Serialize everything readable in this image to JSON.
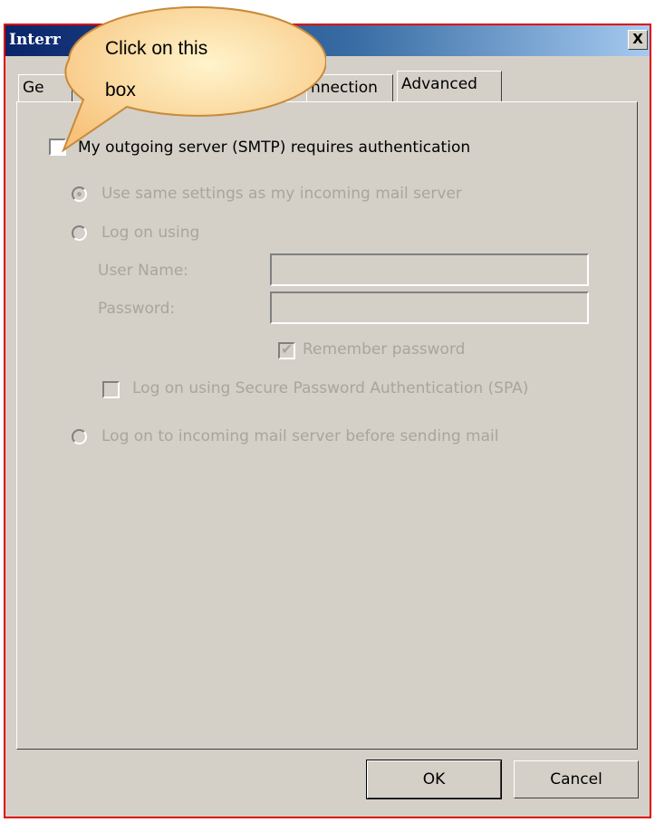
{
  "window": {
    "title": "Interr",
    "close_glyph": "X"
  },
  "tabs": [
    {
      "label": "Ge"
    },
    {
      "label": "nnection"
    },
    {
      "label": "Advanced"
    }
  ],
  "smtp_auth": {
    "label": "My outgoing server (SMTP) requires authentication",
    "checked": false
  },
  "options": {
    "same_settings": {
      "label": "Use same settings as my incoming mail server",
      "selected": true
    },
    "log_on_using": {
      "label": "Log on using",
      "selected": false
    },
    "user_name_label": "User Name:",
    "user_name_value": "",
    "password_label": "Password:",
    "password_value": "",
    "remember_password": {
      "label": "Remember password",
      "checked": true
    },
    "spa": {
      "label": "Log on using Secure Password Authentication (SPA)",
      "checked": false
    },
    "log_on_incoming": {
      "label": "Log on to incoming mail server before sending mail",
      "selected": false
    }
  },
  "buttons": {
    "ok": "OK",
    "cancel": "Cancel"
  },
  "callout": {
    "line1": "Click on this",
    "line2": "box"
  }
}
